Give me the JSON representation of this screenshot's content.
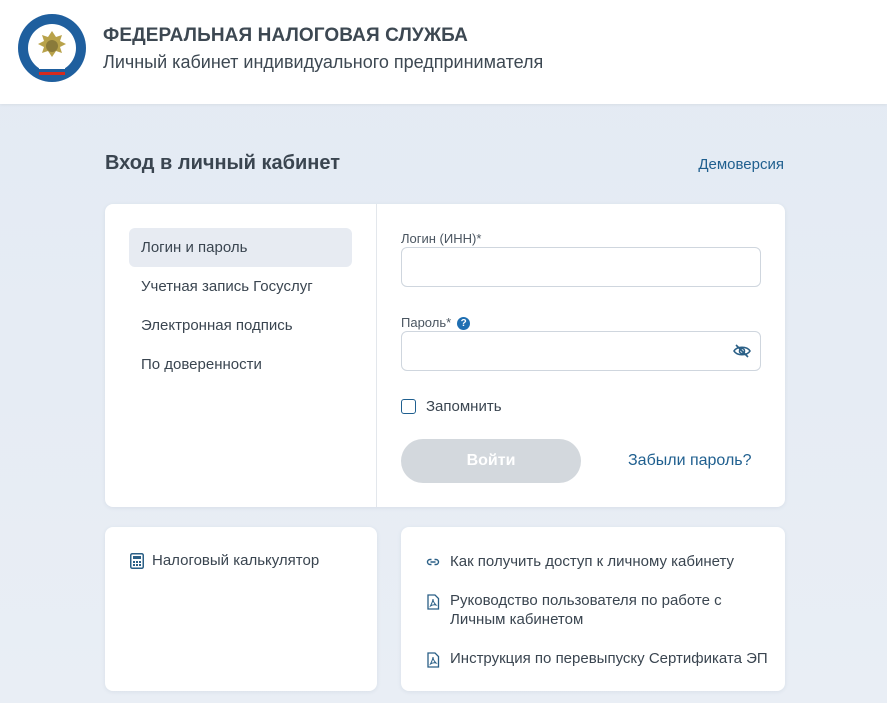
{
  "header": {
    "title": "ФЕДЕРАЛЬНАЯ НАЛОГОВАЯ СЛУЖБА",
    "subtitle": "Личный кабинет индивидуального предпринимателя",
    "logo_text": "ФЕДЕРАЛЬНАЯ НАЛОГОВАЯ СЛУЖБА"
  },
  "page": {
    "title": "Вход в личный кабинет",
    "demo_link": "Демоверсия"
  },
  "login": {
    "methods": [
      {
        "label": "Логин и пароль",
        "active": true
      },
      {
        "label": "Учетная запись Госуслуг",
        "active": false
      },
      {
        "label": "Электронная подпись",
        "active": false
      },
      {
        "label": "По доверенности",
        "active": false
      }
    ],
    "login_label": "Логин (ИНН)*",
    "login_value": "",
    "password_label": "Пароль*",
    "password_help": "?",
    "password_value": "",
    "remember_label": "Запомнить",
    "remember_checked": false,
    "submit_label": "Войти",
    "forgot_label": "Забыли пароль?"
  },
  "tools": {
    "calculator_label": "Налоговый калькулятор"
  },
  "info_links": [
    {
      "label": "Как получить доступ к личному кабинету",
      "icon": "link-icon"
    },
    {
      "label": "Руководство пользователя по работе с Личным кабинетом",
      "icon": "pdf-icon"
    },
    {
      "label": "Инструкция по перевыпуску Сертификата ЭП",
      "icon": "pdf-icon"
    }
  ],
  "colors": {
    "accent": "#1f5f8f",
    "background": "#e6ecf3",
    "button_disabled": "#d3d8dd"
  }
}
